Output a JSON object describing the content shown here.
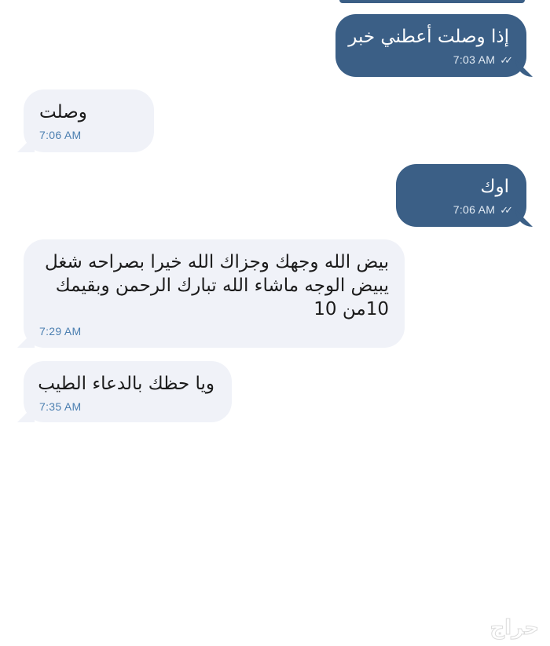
{
  "messages": [
    {
      "direction": "out",
      "text_lines": [
        "إذا وصلت أعطني خبر"
      ],
      "time": "7:03 AM",
      "read": true
    },
    {
      "direction": "in",
      "text_lines": [
        "وصلت"
      ],
      "time": "7:06 AM"
    },
    {
      "direction": "out",
      "text_lines": [
        "اوك"
      ],
      "time": "7:06 AM",
      "read": true
    },
    {
      "direction": "in",
      "text_lines": [
        "بيض الله وجهك وجزاك الله خيرا بصراحه شغل",
        "يبيض الوجه ماشاء الله تبارك الرحمن وبقيمك",
        "10من 10"
      ],
      "time": "7:29 AM"
    },
    {
      "direction": "in",
      "text_lines": [
        "ويا حظك بالدعاء الطيب"
      ],
      "time": "7:35 AM"
    }
  ],
  "read_receipt_glyph": "✓✓",
  "watermark": "حراج",
  "colors": {
    "outgoing_bubble": "#3b5f86",
    "incoming_bubble": "#f0f2f8",
    "incoming_time": "#4a7eb0",
    "background": "#ffffff"
  }
}
